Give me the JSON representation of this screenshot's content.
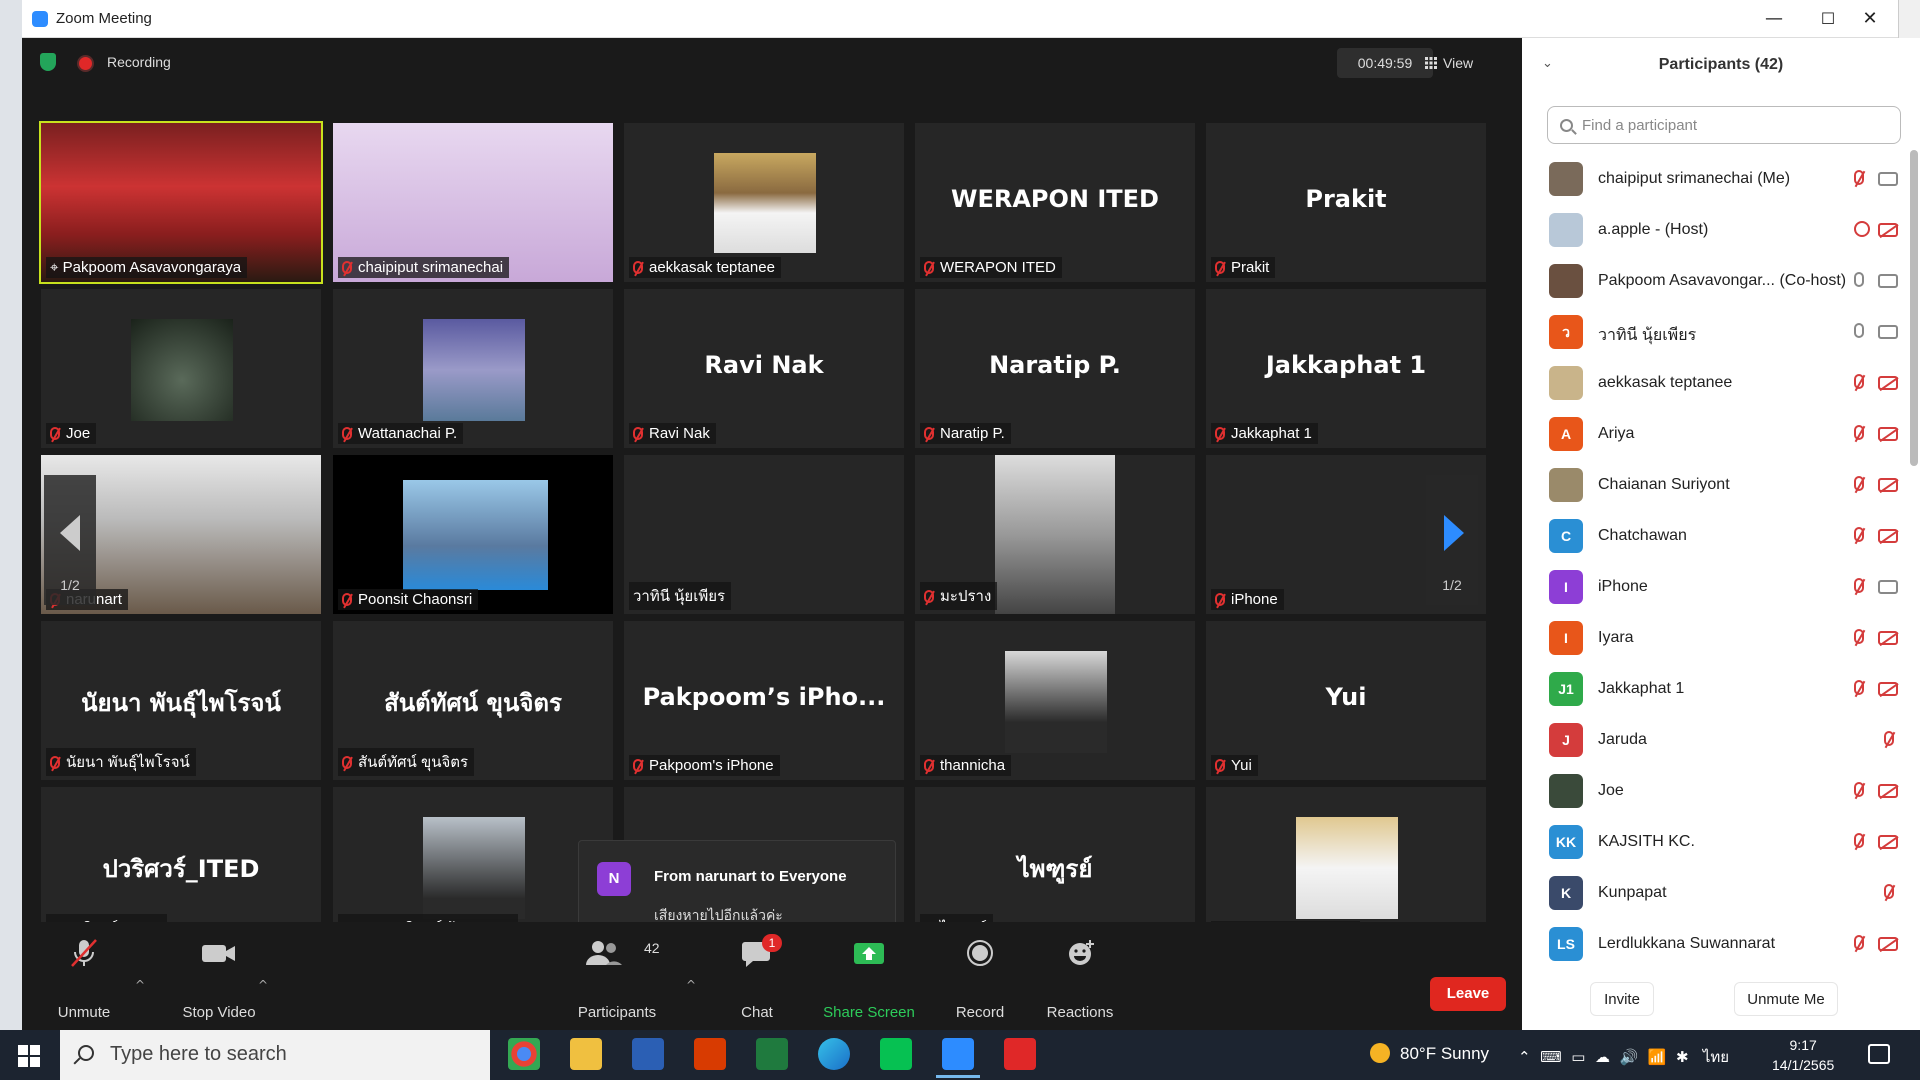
{
  "window": {
    "title": "Zoom Meeting",
    "minimize": "—",
    "maximize": "☐",
    "close": "✕"
  },
  "top": {
    "recording": "Recording",
    "timer": "00:49:59",
    "view": "View"
  },
  "tiles": [
    {
      "name": "Pakpoom Asavavongaraya",
      "big": "",
      "muted": false
    },
    {
      "name": "chaipiput srimanechai",
      "big": "",
      "muted": true
    },
    {
      "name": "aekkasak teptanee",
      "big": "",
      "muted": true
    },
    {
      "name": "WERAPON ITED",
      "big": "WERAPON ITED",
      "muted": true
    },
    {
      "name": "Prakit",
      "big": "Prakit",
      "muted": true
    },
    {
      "name": "Joe",
      "big": "",
      "muted": true
    },
    {
      "name": "Wattanachai P.",
      "big": "",
      "muted": true
    },
    {
      "name": "Ravi Nak",
      "big": "Ravi Nak",
      "muted": true
    },
    {
      "name": "Naratip P.",
      "big": "Naratip P.",
      "muted": true
    },
    {
      "name": "Jakkaphat 1",
      "big": "Jakkaphat 1",
      "muted": true
    },
    {
      "name": "narunart",
      "big": "",
      "muted": true
    },
    {
      "name": "Poonsit Chaonsri",
      "big": "",
      "muted": true
    },
    {
      "name": "วาทินี นุ้ยเพียร",
      "big": "",
      "muted": false
    },
    {
      "name": "มะปราง",
      "big": "",
      "muted": true
    },
    {
      "name": "iPhone",
      "big": "",
      "muted": true
    },
    {
      "name": "นัยนา พันธุ์ไพโรจน์",
      "big": "นัยนา พันธุ์ไพโรจน์",
      "muted": true
    },
    {
      "name": "สันต์ทัศน์ ขุนจิตร",
      "big": "สันต์ทัศน์ ขุนจิตร",
      "muted": true
    },
    {
      "name": "Pakpoom's iPhone",
      "big": "Pakpoom’s iPho...",
      "muted": true
    },
    {
      "name": "thannicha",
      "big": "",
      "muted": true
    },
    {
      "name": "Yui",
      "big": "Yui",
      "muted": true
    },
    {
      "name": "ปวริศวร์_ITED",
      "big": "ปวริศวร์_ITED",
      "muted": true
    },
    {
      "name": "ดร.รสจรินทร์ รัตนสุนทร",
      "big": "",
      "muted": true
    },
    {
      "name": "",
      "big": "",
      "muted": false
    },
    {
      "name": "ไพฑูรย์",
      "big": "ไพฑูรย์",
      "muted": true
    },
    {
      "name": "Chaianan Suriyont",
      "big": "",
      "muted": true
    }
  ],
  "pager": {
    "left": "1/2",
    "right": "1/2"
  },
  "chat_popup": {
    "avatar": "N",
    "from": "From narunart to Everyone",
    "message": "เสียงหายไปอีกแล้วค่ะ"
  },
  "toolbar": {
    "unmute": "Unmute",
    "stop_video": "Stop Video",
    "participants": "Participants",
    "participants_count": "42",
    "chat": "Chat",
    "chat_badge": "1",
    "share": "Share Screen",
    "record": "Record",
    "reactions": "Reactions",
    "leave": "Leave"
  },
  "panel": {
    "title": "Participants (42)",
    "search_placeholder": "Find a participant",
    "invite": "Invite",
    "unmute_me": "Unmute Me",
    "participants": [
      {
        "name": "chaipiput srimanechai (Me)",
        "initials": "",
        "color": "#7a6a5a",
        "mic": "off",
        "cam": "on"
      },
      {
        "name": "a.apple - (Host)",
        "initials": "",
        "color": "#b8c8d8",
        "mic": "ring",
        "cam": "off"
      },
      {
        "name": "Pakpoom Asavavongar... (Co-host)",
        "initials": "",
        "color": "#6a5040",
        "mic": "on",
        "cam": "on"
      },
      {
        "name": "วาทินี นุ้ยเพียร",
        "initials": "ว",
        "color": "#e8561a",
        "mic": "on",
        "cam": "on"
      },
      {
        "name": "aekkasak teptanee",
        "initials": "",
        "color": "#c9b48a",
        "mic": "off",
        "cam": "off"
      },
      {
        "name": "Ariya",
        "initials": "A",
        "color": "#e8561a",
        "mic": "off",
        "cam": "off"
      },
      {
        "name": "Chaianan Suriyont",
        "initials": "",
        "color": "#9a8a6a",
        "mic": "off",
        "cam": "off"
      },
      {
        "name": "Chatchawan",
        "initials": "C",
        "color": "#2a8fd4",
        "mic": "off",
        "cam": "off"
      },
      {
        "name": "iPhone",
        "initials": "I",
        "color": "#8d3ed6",
        "mic": "off",
        "cam": "on"
      },
      {
        "name": "Iyara",
        "initials": "I",
        "color": "#e8561a",
        "mic": "off",
        "cam": "off"
      },
      {
        "name": "Jakkaphat 1",
        "initials": "J1",
        "color": "#2faa4a",
        "mic": "off",
        "cam": "off"
      },
      {
        "name": "Jaruda",
        "initials": "J",
        "color": "#d43c3c",
        "mic": "off",
        "cam": ""
      },
      {
        "name": "Joe",
        "initials": "",
        "color": "#3a4a3a",
        "mic": "off",
        "cam": "off"
      },
      {
        "name": "KAJSITH KC.",
        "initials": "KK",
        "color": "#2a8fd4",
        "mic": "off",
        "cam": "off"
      },
      {
        "name": "Kunpapat",
        "initials": "K",
        "color": "#3a4a6a",
        "mic": "off",
        "cam": ""
      },
      {
        "name": "Lerdlukkana Suwannarat",
        "initials": "LS",
        "color": "#2a8fd4",
        "mic": "off",
        "cam": "off"
      }
    ]
  },
  "taskbar": {
    "search_placeholder": "Type here to search",
    "weather": "80°F  Sunny",
    "lang": "ไทย",
    "time": "9:17",
    "date": "14/1/2565"
  }
}
